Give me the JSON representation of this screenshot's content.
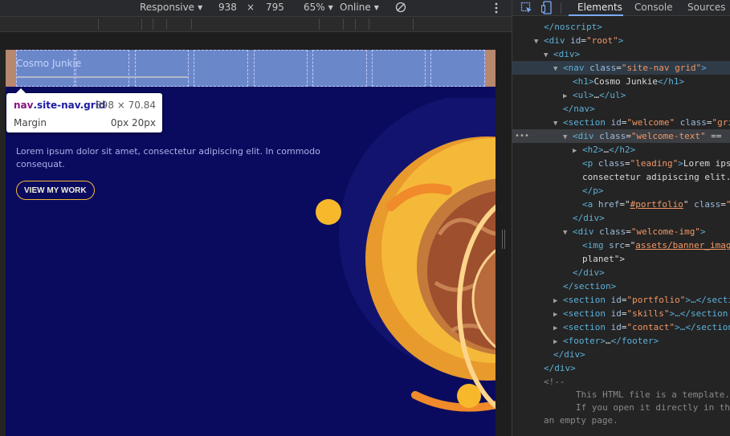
{
  "device_toolbar": {
    "mode": "Responsive",
    "width": "938",
    "times": "×",
    "height": "795",
    "zoom": "65%",
    "throttle": "Online"
  },
  "page": {
    "site_title": "Cosmo Junkie",
    "nav_columns": 8,
    "lead": "Lorem ipsum dolor sit amet, consectetur adipiscing elit. In commodo consequat.",
    "cta": "VIEW MY WORK",
    "colors": {
      "background": "#0a0b5e",
      "overlay": "#6a88c9",
      "margin": "#b7876e",
      "accent": "#f5b93a"
    }
  },
  "tooltip": {
    "tag": "nav",
    "classes": ".site-nav.grid",
    "size": "898 × 70.84",
    "label": "Margin",
    "value": "0px 20px"
  },
  "devtools": {
    "tabs": [
      "Elements",
      "Console",
      "Sources"
    ],
    "active_tab": "Elements",
    "dom": {
      "r0_close": "</",
      "r0_tag": "noscript",
      "r0_end": ">",
      "r1_open": "<",
      "r1_tag": "div",
      "r1_attr": " id",
      "r1_eq": "=",
      "r1_val": "\"root\"",
      "r1_end": ">",
      "r2_open": "<",
      "r2_tag": "div",
      "r2_end": ">",
      "r3_open": "<",
      "r3_tag": "nav",
      "r3_attr": " class",
      "r3_eq": "=",
      "r3_val": "\"site-nav grid\"",
      "r3_end": ">",
      "r4_tag": "h1",
      "r4_text": "Cosmo Junkie",
      "r5_tag": "ul",
      "r5_text": "…",
      "r6_tag": "nav",
      "r7_tag": "section",
      "r7_attr": " id",
      "r7_val": "\"welcome\"",
      "r7_attr2": " class",
      "r7_val2": "\"gri",
      "r8_tag": "div",
      "r8_attr": " class",
      "r8_val": "\"welcome-text\"",
      "r8_suffix": " ==",
      "r9_tag": "h2",
      "r9_text": "…",
      "r10_tag": "p",
      "r10_attr": " class",
      "r10_val": "\"leading\"",
      "r10_text": "Lorem ips",
      "r11_text": "consectetur adipiscing elit.",
      "r12_tag": "p",
      "r13_tag": "a",
      "r13_attr": " href",
      "r13_val": "#portfolio",
      "r13_attr2": " class",
      "r13_val2": "\"",
      "r14_tag": "div",
      "r15_tag": "div",
      "r15_attr": " class",
      "r15_val": "\"welcome-img\"",
      "r16_tag": "img",
      "r16_attr": " src",
      "r16_val": "assets/banner_imag",
      "r17_text": "planet\">",
      "r18_tag": "div",
      "r19_tag": "section",
      "r20_tag": "section",
      "r20_attr": " id",
      "r20_val": "\"portfolio\"",
      "r20_text": "…</secti",
      "r21_tag": "section",
      "r21_attr": " id",
      "r21_val": "\"skills\"",
      "r21_text": "…</section",
      "r22_tag": "section",
      "r22_attr": " id",
      "r22_val": "\"contact\"",
      "r22_text": "…</section",
      "r23_tag": "footer",
      "r23_text": "…",
      "r24_tag": "div",
      "r25_tag": "div",
      "r26_text": "<!--",
      "r27_text": "This HTML file is a template.",
      "r28_text": "If you open it directly in the",
      "r29_text": "an empty page."
    }
  }
}
